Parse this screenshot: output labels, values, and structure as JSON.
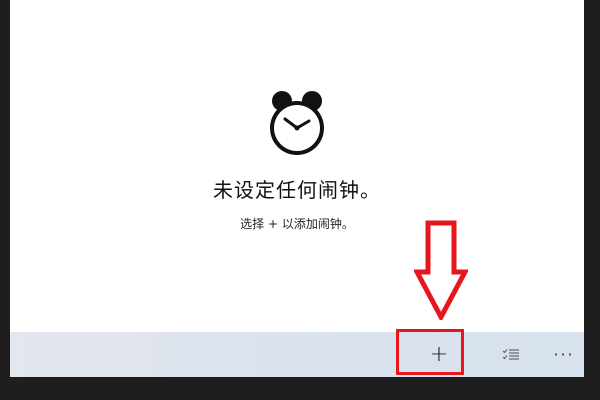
{
  "empty_state": {
    "icon": "alarm-clock-icon",
    "title": "未设定任何闹钟。",
    "hint": "选择 + 以添加闹钟。"
  },
  "command_bar": {
    "add_label": "+",
    "select_icon": "select-list-icon",
    "more_label": "···"
  },
  "annotation": {
    "arrow_icon": "down-arrow-icon",
    "color": "#e8161c"
  }
}
